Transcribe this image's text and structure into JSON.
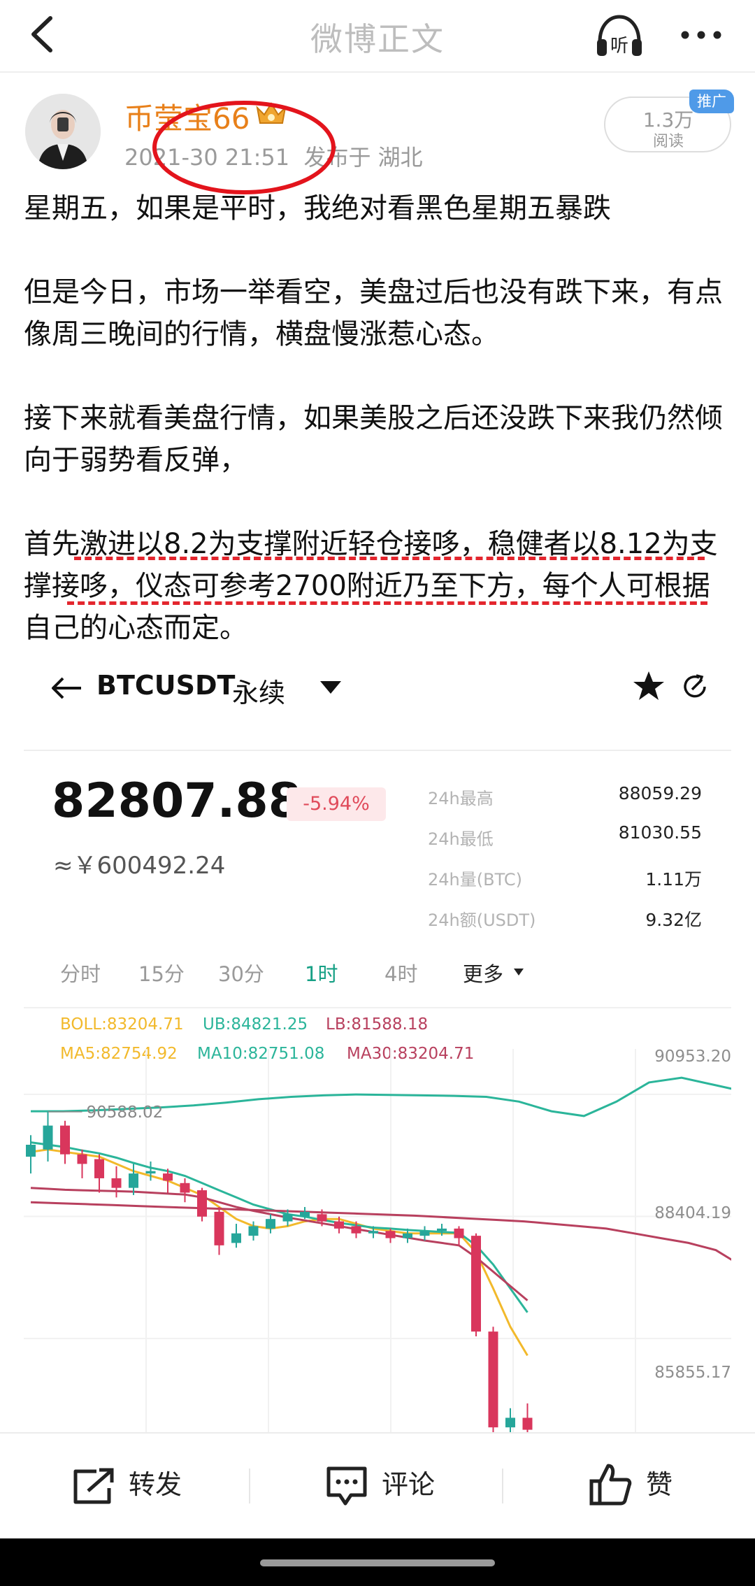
{
  "nav": {
    "title": "微博正文",
    "listen_label": "听"
  },
  "author": {
    "name": "币莹宝66",
    "meta": "2021-30 21:51  发布于 湖北",
    "reads": "1.3万",
    "reads_label": "阅读",
    "promo_tag": "推广"
  },
  "post": {
    "paragraphs": [
      "星期五，如果是平时，我绝对看黑色星期五暴跌",
      "但是今日，市场一举看空，美盘过后也没有跌下来，有点像周三晚间的行情，横盘慢涨惹心态。",
      "接下来就看美盘行情，如果美股之后还没跌下来我仍然倾向于弱势看反弹，",
      "首先激进以8.2为支撑附近轻仓接哆，稳健者以8.12为支撑接哆，仪态可参考2700附近乃至下方，每个人可根据自己的心态而定。"
    ]
  },
  "trade": {
    "pair": "BTCUSDT",
    "contract": "永续",
    "last_price": "82807.88",
    "change": "-5.94%",
    "cny_price": "≈￥600492.24",
    "stats": [
      {
        "label": "24h最高",
        "value": "88059.29"
      },
      {
        "label": "24h最低",
        "value": "81030.55"
      },
      {
        "label": "24h量(BTC)",
        "value": "1.11万"
      },
      {
        "label": "24h额(USDT)",
        "value": "9.32亿"
      }
    ],
    "timeframes": [
      "分时",
      "15分",
      "30分",
      "1时",
      "4时",
      "更多"
    ],
    "active_timeframe": "1时",
    "indicators": {
      "boll": "BOLL:83204.71",
      "ub": "UB:84821.25",
      "lb": "LB:81588.18",
      "ma5": "MA5:82754.92",
      "ma10": "MA10:82751.08",
      "ma30": "MA30:83204.71"
    },
    "colors": {
      "up": "#26a69a",
      "down": "#d9365c",
      "ma5": "#f2b92b",
      "ma10": "#2bb59a",
      "ma30": "#b8405e"
    }
  },
  "chart_data": {
    "type": "candlestick",
    "title": "",
    "xlabel": "",
    "ylabel": "",
    "ylim": [
      83900,
      91900
    ],
    "y_ticks": [
      "90953.20",
      "88404.19",
      "85855.17"
    ],
    "y_tick_values": [
      90953.2,
      88404.19,
      85855.17
    ],
    "high_marker": "90588.02",
    "candles": [
      {
        "o": 89650,
        "c": 89900,
        "h": 90100,
        "l": 89300
      },
      {
        "o": 89800,
        "c": 90300,
        "h": 90588,
        "l": 89550
      },
      {
        "o": 90300,
        "c": 89700,
        "h": 90400,
        "l": 89500
      },
      {
        "o": 89700,
        "c": 89500,
        "h": 89800,
        "l": 89200
      },
      {
        "o": 89600,
        "c": 89200,
        "h": 89700,
        "l": 88900
      },
      {
        "o": 89200,
        "c": 89000,
        "h": 89450,
        "l": 88800
      },
      {
        "o": 89000,
        "c": 89300,
        "h": 89500,
        "l": 88850
      },
      {
        "o": 89300,
        "c": 89350,
        "h": 89550,
        "l": 89150
      },
      {
        "o": 89300,
        "c": 89150,
        "h": 89400,
        "l": 88900
      },
      {
        "o": 89100,
        "c": 88900,
        "h": 89200,
        "l": 88700
      },
      {
        "o": 88950,
        "c": 88400,
        "h": 89000,
        "l": 88300
      },
      {
        "o": 88500,
        "c": 87800,
        "h": 88600,
        "l": 87600
      },
      {
        "o": 87850,
        "c": 88050,
        "h": 88250,
        "l": 87750
      },
      {
        "o": 88000,
        "c": 88200,
        "h": 88300,
        "l": 87900
      },
      {
        "o": 88150,
        "c": 88350,
        "h": 88450,
        "l": 88050
      },
      {
        "o": 88300,
        "c": 88450,
        "h": 88550,
        "l": 88200
      },
      {
        "o": 88400,
        "c": 88500,
        "h": 88600,
        "l": 88350
      },
      {
        "o": 88450,
        "c": 88300,
        "h": 88550,
        "l": 88200
      },
      {
        "o": 88300,
        "c": 88150,
        "h": 88400,
        "l": 88050
      },
      {
        "o": 88200,
        "c": 88050,
        "h": 88300,
        "l": 87950
      },
      {
        "o": 88050,
        "c": 88100,
        "h": 88200,
        "l": 87950
      },
      {
        "o": 88100,
        "c": 87950,
        "h": 88150,
        "l": 87850
      },
      {
        "o": 87950,
        "c": 88050,
        "h": 88150,
        "l": 87850
      },
      {
        "o": 88000,
        "c": 88100,
        "h": 88200,
        "l": 87900
      },
      {
        "o": 88100,
        "c": 88150,
        "h": 88250,
        "l": 88000
      },
      {
        "o": 88150,
        "c": 87950,
        "h": 88200,
        "l": 87800
      },
      {
        "o": 88000,
        "c": 86000,
        "h": 88050,
        "l": 85900
      },
      {
        "o": 86000,
        "c": 84000,
        "h": 86100,
        "l": 83900
      },
      {
        "o": 84000,
        "c": 84200,
        "h": 84400,
        "l": 83900
      },
      {
        "o": 84200,
        "c": 83950,
        "h": 84500,
        "l": 83900
      }
    ],
    "series": [
      {
        "name": "MA5",
        "values": [
          89750,
          89800,
          89750,
          89700,
          89650,
          89500,
          89350,
          89250,
          89150,
          89000,
          88850,
          88600,
          88350,
          88200,
          88150,
          88200,
          88300,
          88350,
          88350,
          88250,
          88150,
          88100,
          88050,
          88050,
          88050,
          88050,
          87650,
          86900,
          86100,
          85500
        ]
      },
      {
        "name": "MA10",
        "values": [
          89950,
          89900,
          89850,
          89780,
          89720,
          89630,
          89520,
          89420,
          89350,
          89250,
          89100,
          88950,
          88800,
          88650,
          88550,
          88450,
          88400,
          88330,
          88270,
          88220,
          88170,
          88150,
          88120,
          88100,
          88080,
          88060,
          87800,
          87400,
          86900,
          86400
        ]
      },
      {
        "name": "MA30",
        "values": [
          89000,
          88980,
          88960,
          88950,
          88940,
          88930,
          88920,
          88900,
          88880,
          88860,
          88800,
          88700,
          88600,
          88520,
          88450,
          88380,
          88320,
          88260,
          88200,
          88140,
          88080,
          88020,
          87960,
          87900,
          87850,
          87800,
          87550,
          87250,
          86950,
          86650
        ]
      },
      {
        "name": "UB",
        "values": [
          90600,
          90600,
          90620,
          90650,
          90680,
          90720,
          90780,
          90850,
          90900,
          90930,
          90950,
          90940,
          90930,
          90920,
          90900,
          90800,
          90600,
          90500,
          90800,
          91200,
          91300,
          91150,
          91000,
          90900,
          90800,
          90600,
          90000,
          89200,
          88400,
          87600
        ]
      },
      {
        "name": "LB",
        "values": [
          88700,
          88680,
          88660,
          88640,
          88620,
          88600,
          88580,
          88560,
          88540,
          88520,
          88500,
          88480,
          88460,
          88440,
          88420,
          88390,
          88360,
          88330,
          88300,
          88250,
          88200,
          88150,
          88050,
          87950,
          87850,
          87700,
          87350,
          86800,
          86200,
          85600
        ]
      }
    ]
  },
  "actions": {
    "repost": "转发",
    "comment": "评论",
    "like": "赞"
  }
}
